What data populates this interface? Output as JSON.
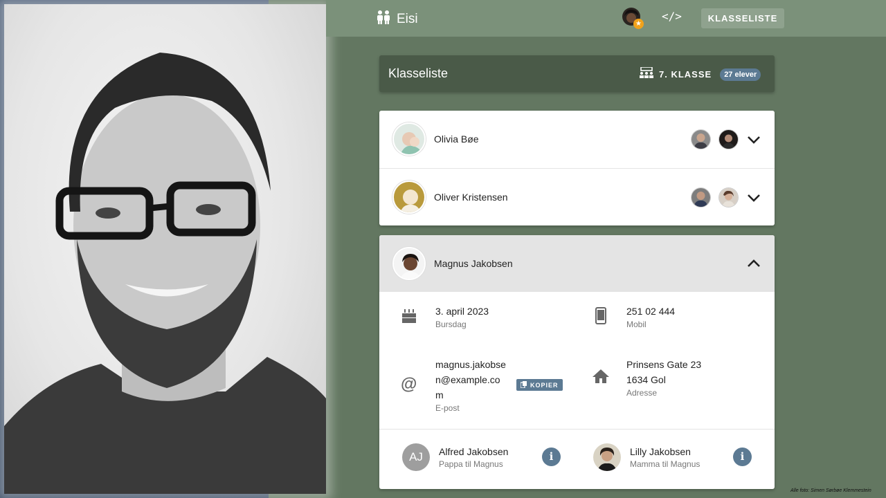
{
  "app": {
    "title": "Eisi"
  },
  "topbar": {
    "code_label": "</>",
    "klasseliste_label": "KLASSELISTE"
  },
  "header": {
    "title": "Klasseliste",
    "class_label": "7. KLASSE",
    "count_badge": "27 elever"
  },
  "students": [
    {
      "name": "Olivia Bøe"
    },
    {
      "name": "Oliver Kristensen"
    }
  ],
  "selected_student": {
    "name": "Magnus Jakobsen",
    "birthday": {
      "value": "3. april 2023",
      "label": "Bursdag"
    },
    "mobile": {
      "value": "251 02 444",
      "label": "Mobil"
    },
    "email": {
      "line1": "magnus.jakobse",
      "line2": "n@example.co",
      "line3": "m",
      "label": "E-post",
      "copy_label": "KOPIER"
    },
    "address": {
      "line1": "Prinsens Gate 23",
      "line2": "1634 Gol",
      "label": "Adresse"
    },
    "parents": [
      {
        "initials": "AJ",
        "name": "Alfred Jakobsen",
        "role": "Pappa til Magnus"
      },
      {
        "initials": "",
        "name": "Lilly Jakobsen",
        "role": "Mamma til Magnus"
      }
    ]
  },
  "icons": {
    "brand": "family-icon",
    "code": "code-icon",
    "class": "classroom-icon",
    "birthday": "cake-icon",
    "mobile": "phone-icon",
    "email": "at-icon",
    "address": "home-icon",
    "copy": "copy-icon",
    "info": "info-icon",
    "expand": "chevron-down-icon",
    "collapse": "chevron-up-icon"
  },
  "colors": {
    "topbar": "#7b917a",
    "background": "#637761",
    "header": "#4a5a48",
    "accent": "#5c7a93"
  },
  "credit": "Alle foto: Simen Sørbøe Klemmestein"
}
